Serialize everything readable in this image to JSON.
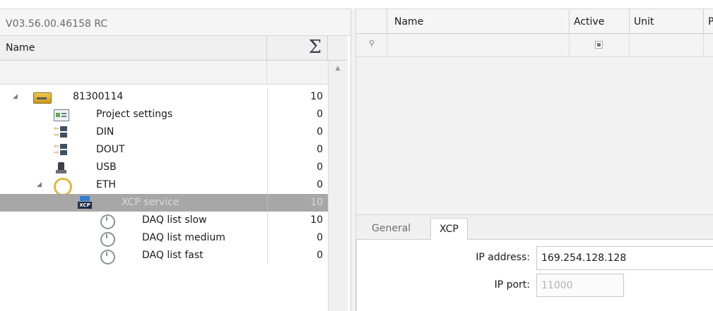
{
  "left_panel": {
    "version": "V03.56.00.46158 RC",
    "header": {
      "name_label": "Name",
      "sum_icon": "sigma-icon"
    },
    "tree": [
      {
        "label": "81300114",
        "value": "10",
        "icon": "device-icon",
        "expanded": true
      },
      {
        "label": "Project settings",
        "value": "0",
        "icon": "settings-icon"
      },
      {
        "label": "DIN",
        "value": "0",
        "icon": "digital-io-icon"
      },
      {
        "label": "DOUT",
        "value": "0",
        "icon": "digital-io-icon"
      },
      {
        "label": "USB",
        "value": "0",
        "icon": "usb-icon"
      },
      {
        "label": "ETH",
        "value": "0",
        "icon": "ethernet-icon",
        "expanded": true
      },
      {
        "label": "XCP service",
        "value": "10",
        "icon": "xcp-icon",
        "selected": true
      },
      {
        "label": "DAQ list slow",
        "value": "10",
        "icon": "timer-icon"
      },
      {
        "label": "DAQ list medium",
        "value": "0",
        "icon": "timer-icon"
      },
      {
        "label": "DAQ list fast",
        "value": "0",
        "icon": "timer-icon"
      }
    ]
  },
  "grid": {
    "columns": [
      "Name",
      "Active",
      "Unit",
      "P"
    ],
    "filter_icon": "filter-icon",
    "active_filter_state": "indeterminate"
  },
  "tabs": {
    "items": [
      "General",
      "XCP"
    ],
    "active": "XCP"
  },
  "xcp_props": {
    "ip_address_label": "IP address:",
    "ip_address_value": "169.254.128.128",
    "ip_port_label": "IP port:",
    "ip_port_value": "11000"
  },
  "colors": {
    "selected_row": "#a7a7a7",
    "panel_bg": "#f2f2f2"
  }
}
